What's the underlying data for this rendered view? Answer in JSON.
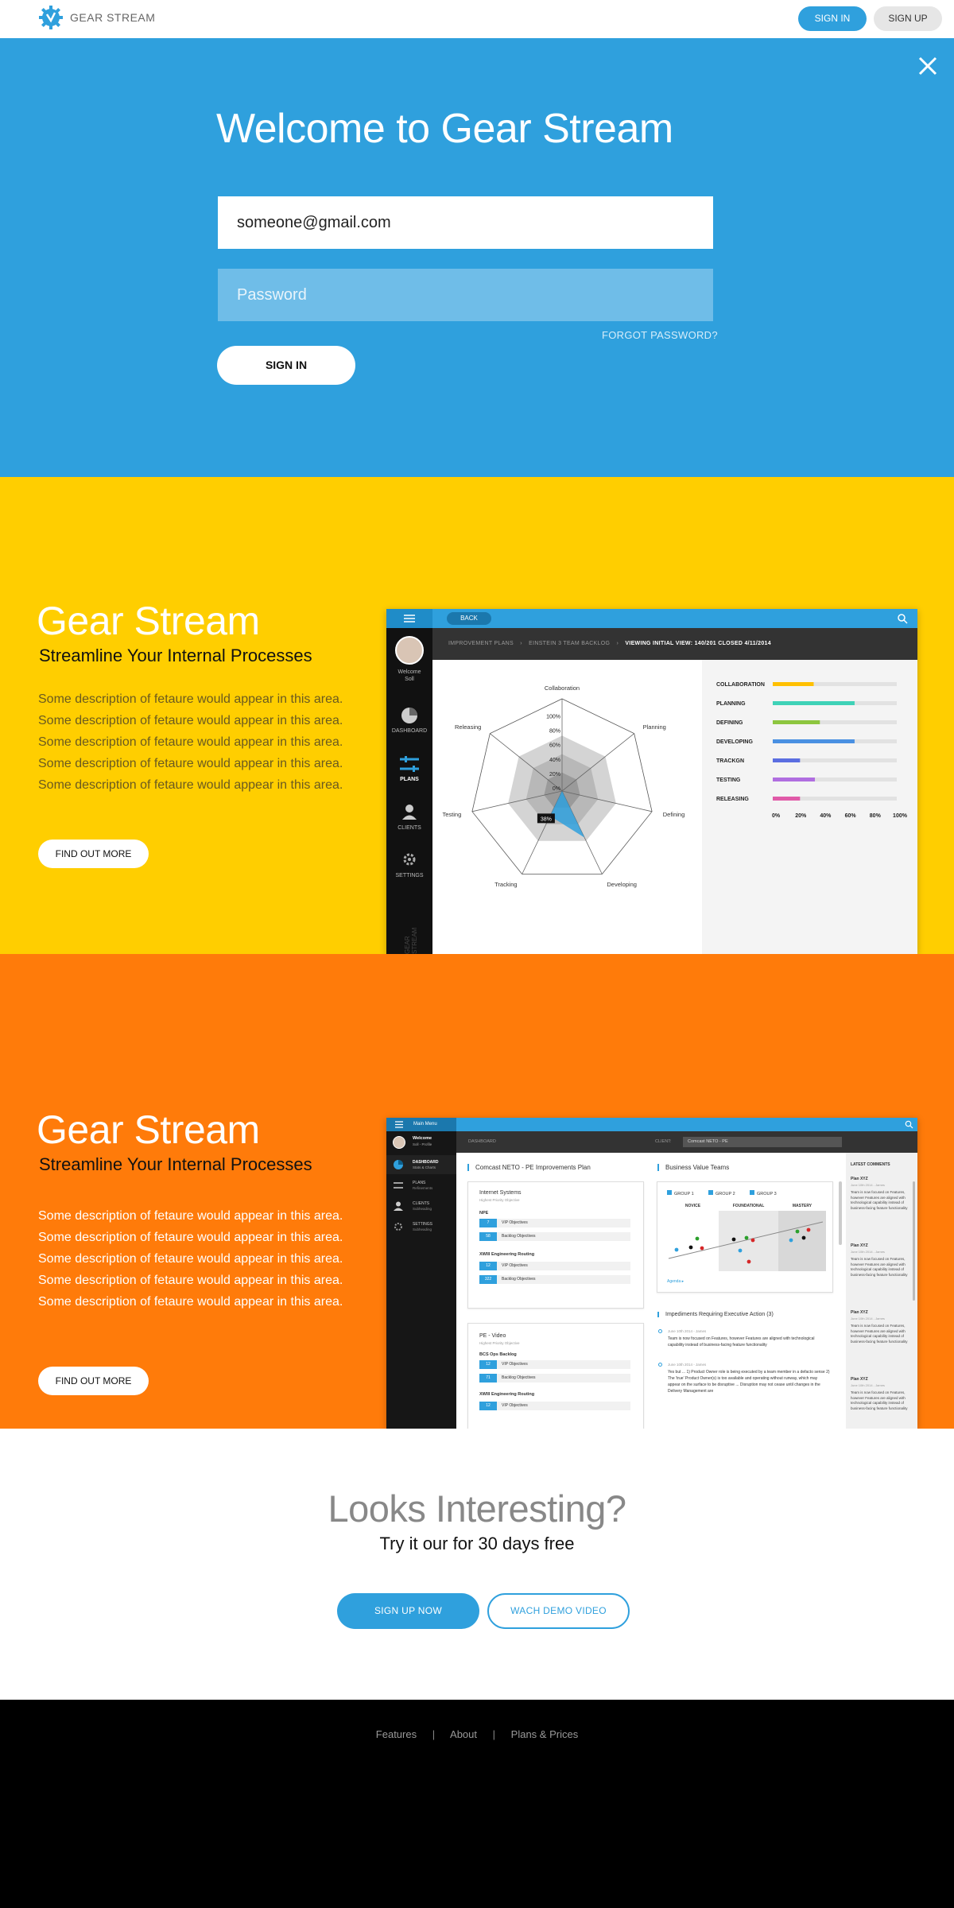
{
  "header": {
    "brand": "GEAR STREAM",
    "sign_in": "SIGN IN",
    "sign_up": "SIGN UP"
  },
  "login": {
    "title": "Welcome to Gear Stream",
    "email_value": "someone@gmail.com",
    "password_placeholder": "Password",
    "forgot": "FORGOT PASSWORD?",
    "submit": "SIGN IN"
  },
  "feature1": {
    "title": "Gear Stream",
    "subtitle": "Streamline Your Internal Processes",
    "description": "Some description of fetaure would appear in this area. Some description of fetaure would appear in this area. Some description of fetaure would appear in this area. Some description of fetaure would appear in this area. Some description of fetaure would appear in this area.",
    "button": "FIND OUT MORE",
    "shot": {
      "back": "BACK",
      "crumb1": "IMPROVEMENT PLANS",
      "crumb2": "EINSTEIN 3 TEAM BACKLOG",
      "crumb3": "VIEWING INITIAL VIEW: 140/201 CLOSED 4/11/2014",
      "welcome": "Welcome",
      "user": "Soll",
      "nav": [
        "DASHBOARD",
        "PLANS",
        "CLIENTS",
        "SETTINGS"
      ],
      "vertical": "GEAR STREAM",
      "radar_axes": [
        "Collaboration",
        "Planning",
        "Defining",
        "Developing",
        "Tracking",
        "Testing",
        "Releasing"
      ],
      "radar_ticks": [
        "100%",
        "80%",
        "60%",
        "40%",
        "20%",
        "0%"
      ],
      "radar_callout": "38%",
      "bars": [
        {
          "label": "COLLABORATION",
          "value": 0.33,
          "color": "#ffc000"
        },
        {
          "label": "PLANNING",
          "value": 0.66,
          "color": "#3fd2b7"
        },
        {
          "label": "DEFINING",
          "value": 0.38,
          "color": "#8dc63f"
        },
        {
          "label": "DEVELOPING",
          "value": 0.66,
          "color": "#4a90e2"
        },
        {
          "label": "TRACKGN",
          "value": 0.22,
          "color": "#5b6ee1"
        },
        {
          "label": "TESTING",
          "value": 0.34,
          "color": "#b06ee0"
        },
        {
          "label": "RELEASING",
          "value": 0.22,
          "color": "#e05aa8"
        }
      ],
      "bar_ticks": [
        "0%",
        "20%",
        "40%",
        "60%",
        "80%",
        "100%"
      ]
    }
  },
  "feature2": {
    "title": "Gear Stream",
    "subtitle": "Streamline Your Internal Processes",
    "description": "Some description of fetaure would appear in this area. Some description of fetaure would appear in this area. Some description of fetaure would appear in this area. Some description of fetaure would appear in this area. Some description of fetaure would appear in this area.",
    "button": "FIND OUT MORE",
    "shot": {
      "menu": "Main Menu",
      "welcome": "Welcome",
      "user": "Soll - Profile",
      "nav": [
        {
          "label": "DASHBOARD",
          "sub": "Stats & Charts"
        },
        {
          "label": "PLANS",
          "sub": "Refinements"
        },
        {
          "label": "CLIENTS",
          "sub": "Subheading"
        },
        {
          "label": "SETTINGS",
          "sub": "Subheading"
        }
      ],
      "topbar": "DASHBOARD",
      "client_label": "CLIENT:",
      "client_value": "Comcast NETO - PE",
      "plan_title": "Comcast NETO - PE Improvements Plan",
      "card1_title": "Internet Systems",
      "card1_sub": "Highest Priority Objective",
      "card1_group1": "NPE",
      "card1_rows1": [
        {
          "num": "7",
          "label": "VIP Objectives"
        },
        {
          "num": "58",
          "label": "Backlog Objectives"
        }
      ],
      "card1_group2": "XWIII Engineering Routing",
      "card1_rows2": [
        {
          "num": "12",
          "label": "VIP Objectives"
        },
        {
          "num": "322",
          "label": "Backlog Objectives"
        }
      ],
      "card2_title": "PE - Video",
      "card2_sub": "Highest Priority Objective",
      "card2_group1": "BCS Ops Backlog",
      "card2_rows1": [
        {
          "num": "12",
          "label": "VIP Objectives"
        },
        {
          "num": "71",
          "label": "Backlog Objectives"
        }
      ],
      "card2_group2": "XWIII Engineering Routing",
      "card2_rows2": [
        {
          "num": "12",
          "label": "VIP Objectives"
        }
      ],
      "bvt_title": "Business Value Teams",
      "bvt_groups": [
        "GROUP 1",
        "GROUP 2",
        "GROUP 3"
      ],
      "bvt_cols": [
        "NOVICE",
        "FOUNDATIONAL",
        "MASTERY"
      ],
      "bvt_link": "Agenda",
      "imp_title": "Impediments Requiring Executive Action (3)",
      "imp_items": [
        {
          "meta": "June 10th 2014 - James",
          "text": "Team is now focused on Features, however Features are aligned with technological capability instead of business-facing feature functionality"
        },
        {
          "meta": "June 10th 2014 - James",
          "text": "Yes but ... 1) Product Owner role is being executed by a team member in a defacto sense 2) The 'true' Product Owner(s) is too available and operating without runway, which may appear on the surface to be disruptive ... Disruption may not cease until changes in the Delivery Management are"
        }
      ],
      "comments_title": "LATEST COMMENTS",
      "comments": [
        {
          "title": "Plan XYZ",
          "meta": "June 10th 2014 - James",
          "text": "Team is now focused on Features, however Features are aligned with technological capability instead of business-facing feature functionality"
        },
        {
          "title": "Plan XYZ",
          "meta": "June 10th 2014 - James",
          "text": "Team is now focused on Features, however Features are aligned with technological capability instead of business-facing feature functionality"
        },
        {
          "title": "Plan XYZ",
          "meta": "June 10th 2014 - James",
          "text": "Team is now focused on Features, however Features are aligned with technological capability instead of business-facing feature functionality"
        },
        {
          "title": "Plan XYZ",
          "meta": "June 10th 2014 - James",
          "text": "Team is now focused on Features, however Features are aligned with technological capability instead of business-facing feature functionality"
        }
      ]
    }
  },
  "cta": {
    "title": "Looks Interesting?",
    "subtitle": "Try it our for 30 days free",
    "signup": "SIGN UP NOW",
    "demo": "WACH DEMO VIDEO"
  },
  "footer": {
    "links": [
      "Features",
      "About",
      "Plans & Prices"
    ],
    "separator": "|"
  },
  "colors": {
    "blue": "#2fa0dd",
    "yellow": "#ffce00",
    "orange": "#ff7b0a",
    "footer": "#000000"
  }
}
